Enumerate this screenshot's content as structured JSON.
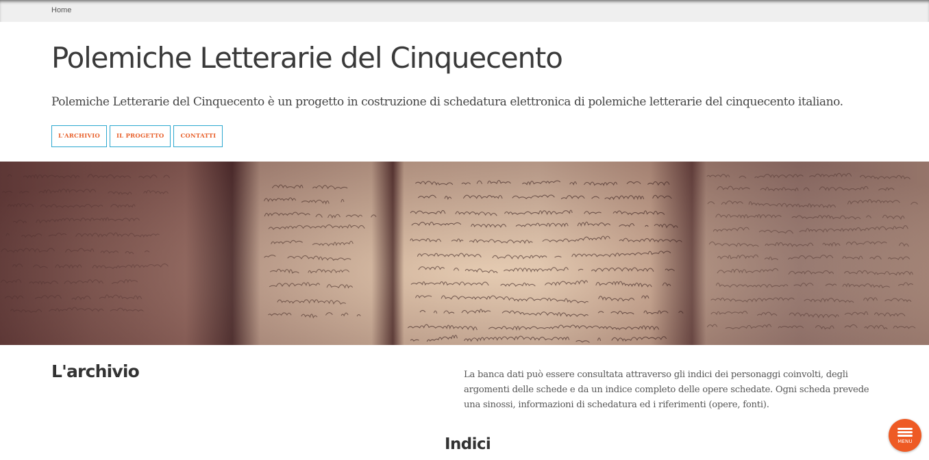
{
  "breadcrumb": {
    "home": "Home"
  },
  "header": {
    "title": "Polemiche Letterarie del Cinquecento",
    "intro": "Polemiche Letterarie del Cinquecento è un progetto in costruzione di schedatura elettronica di polemiche letterarie del cinquecento italiano."
  },
  "nav": {
    "archivio": "L'ARCHIVIO",
    "progetto": "IL PROGETTO",
    "contatti": "CONTATTI"
  },
  "section": {
    "title": "L'archivio",
    "text": "La banca dati può essere consultata attraverso gli indici dei personaggi coinvolti, degli argomenti delle schede e da un indice completo delle opere schedate. Ogni scheda prevede una sinossi, informazioni di schedatura ed i riferimenti (opere, fonti).",
    "subheading": "Indici"
  },
  "menu": {
    "label": "MENU",
    "icon": "hamburger-icon"
  },
  "colors": {
    "accent": "#e8612c",
    "button_border": "#2aa7cf",
    "fab": "#ee5a24"
  }
}
